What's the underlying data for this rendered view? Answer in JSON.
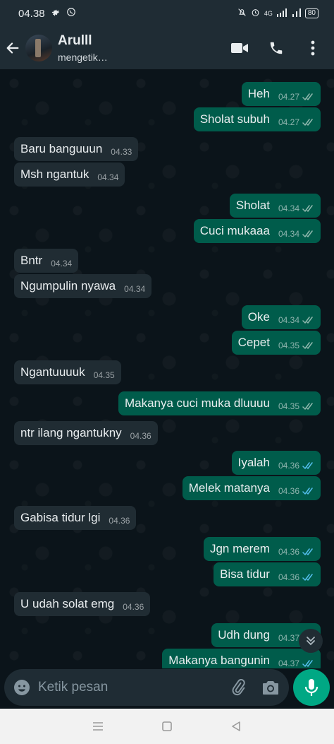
{
  "status_bar": {
    "time": "04.38",
    "network": "4G",
    "battery": "80"
  },
  "header": {
    "contact_name": "Arulll",
    "contact_status": "mengetik…"
  },
  "messages": [
    {
      "dir": "out",
      "text": "Heh",
      "time": "04.27",
      "status": "delivered"
    },
    {
      "dir": "out",
      "text": "Sholat subuh",
      "time": "04.27",
      "status": "delivered"
    },
    {
      "dir": "in",
      "text": "Baru banguuun",
      "time": "04.33"
    },
    {
      "dir": "in",
      "text": "Msh ngantuk",
      "time": "04.34"
    },
    {
      "dir": "out",
      "text": "Sholat",
      "time": "04.34",
      "status": "delivered"
    },
    {
      "dir": "out",
      "text": "Cuci mukaaa",
      "time": "04.34",
      "status": "delivered"
    },
    {
      "dir": "in",
      "text": "Bntr",
      "time": "04.34"
    },
    {
      "dir": "in",
      "text": "Ngumpulin nyawa",
      "time": "04.34"
    },
    {
      "dir": "out",
      "text": "Oke",
      "time": "04.34",
      "status": "delivered"
    },
    {
      "dir": "out",
      "text": "Cepet",
      "time": "04.35",
      "status": "delivered"
    },
    {
      "dir": "in",
      "text": "Ngantuuuuk",
      "time": "04.35"
    },
    {
      "dir": "out",
      "text": "Makanya cuci muka dluuuu",
      "time": "04.35",
      "status": "delivered"
    },
    {
      "dir": "in",
      "text": "ntr ilang ngantukny",
      "time": "04.36"
    },
    {
      "dir": "out",
      "text": "Iyalah",
      "time": "04.36",
      "status": "read"
    },
    {
      "dir": "out",
      "text": "Melek matanya",
      "time": "04.36",
      "status": "read"
    },
    {
      "dir": "in",
      "text": "Gabisa tidur lgi",
      "time": "04.36"
    },
    {
      "dir": "out",
      "text": "Jgn merem",
      "time": "04.36",
      "status": "read"
    },
    {
      "dir": "out",
      "text": "Bisa tidur",
      "time": "04.36",
      "status": "read"
    },
    {
      "dir": "in",
      "text": "U udah solat emg",
      "time": "04.36"
    },
    {
      "dir": "out",
      "text": "Udh dung",
      "time": "04.37",
      "status": "read"
    },
    {
      "dir": "out",
      "text": "Makanya bangunin",
      "time": "04.37",
      "status": "read"
    }
  ],
  "composer": {
    "placeholder": "Ketik pesan"
  },
  "colors": {
    "accent": "#00a884",
    "outgoing_bubble": "#005c4b",
    "incoming_bubble": "#202c33",
    "read_tick": "#53bdeb",
    "delivered_tick": "#8fb7ad"
  },
  "icons": {
    "back": "arrow-left-icon",
    "video": "video-camera-icon",
    "call": "phone-icon",
    "menu": "more-vertical-icon",
    "emoji": "emoji-icon",
    "attach": "paperclip-icon",
    "camera": "camera-icon",
    "mic": "microphone-icon",
    "scroll": "chevron-double-down-icon"
  }
}
